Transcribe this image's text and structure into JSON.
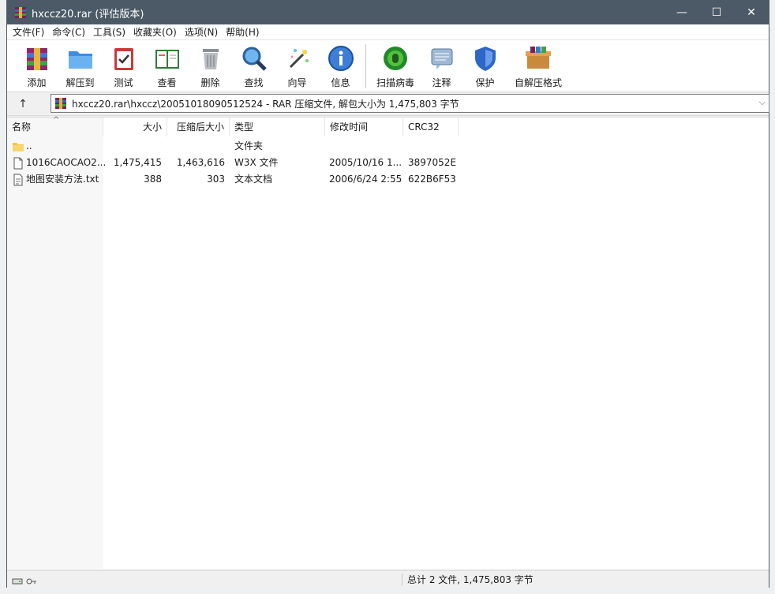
{
  "window": {
    "title": "hxccz20.rar (评估版本)",
    "controls": {
      "minimize": "—",
      "maximize": "☐",
      "close": "✕"
    }
  },
  "menu": [
    "文件(F)",
    "命令(C)",
    "工具(S)",
    "收藏夹(O)",
    "选项(N)",
    "帮助(H)"
  ],
  "toolbar": {
    "add": "添加",
    "extract": "解压到",
    "test": "测试",
    "view": "查看",
    "delete": "删除",
    "find": "查找",
    "wizard": "向导",
    "info": "信息",
    "scan": "扫描病毒",
    "comment": "注释",
    "protect": "保护",
    "sfx": "自解压格式"
  },
  "address": {
    "up": "↑",
    "path": "hxccz20.rar\\hxccz\\20051018090512524 - RAR 压缩文件, 解包大小为 1,475,803 字节",
    "dropdown": "⌵"
  },
  "columns": {
    "name": "名称",
    "size": "大小",
    "packed": "压缩后大小",
    "type": "类型",
    "modified": "修改时间",
    "crc": "CRC32",
    "sort_indicator": "^"
  },
  "files": [
    {
      "name": "..",
      "size": "",
      "packed": "",
      "type": "文件夹",
      "modified": "",
      "crc": "",
      "icon": "folder-icon"
    },
    {
      "name": "1016CAOCAO2...",
      "size": "1,475,415",
      "packed": "1,463,616",
      "type": "W3X 文件",
      "modified": "2005/10/16 1...",
      "crc": "3897052E",
      "icon": "file-icon"
    },
    {
      "name": "地图安装方法.txt",
      "size": "388",
      "packed": "303",
      "type": "文本文档",
      "modified": "2006/6/24 2:55",
      "crc": "622B6F53",
      "icon": "text-file-icon"
    }
  ],
  "status": {
    "summary": "总计 2 文件, 1,475,803 字节"
  },
  "colors": {
    "titlebar": "#4b5a66",
    "window_bg": "#f0f0f0"
  }
}
